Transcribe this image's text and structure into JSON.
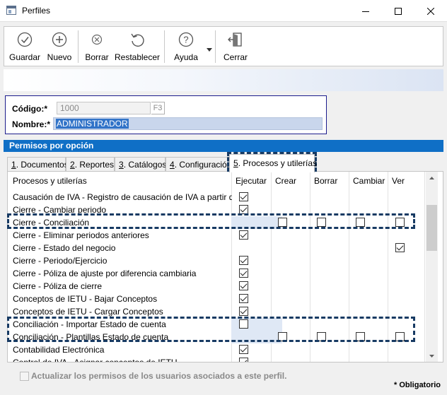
{
  "window": {
    "title": "Perfiles"
  },
  "toolbar": {
    "guardar": "Guardar",
    "nuevo": "Nuevo",
    "borrar": "Borrar",
    "restablecer": "Restablecer",
    "ayuda": "Ayuda",
    "cerrar": "Cerrar"
  },
  "form": {
    "codigo_label": "Código:*",
    "codigo_value": "1000",
    "codigo_hint": "F3",
    "nombre_label": "Nombre:*",
    "nombre_value": "ADMINISTRADOR"
  },
  "section_title": "Permisos por opción",
  "tabs": [
    {
      "key": "1",
      "label": ". Documentos"
    },
    {
      "key": "2",
      "label": ". Reportes"
    },
    {
      "key": "3",
      "label": ". Catálogos"
    },
    {
      "key": "4",
      "label": ". Configuración"
    },
    {
      "key": "5",
      "label": ". Procesos y utilerías",
      "active": true
    }
  ],
  "grid": {
    "columns": [
      "Procesos y utilerías",
      "Ejecutar",
      "Crear",
      "Borrar",
      "Cambiar",
      "Ver"
    ],
    "rows": [
      {
        "name": "Causación de IVA - Registro de causación de IVA a partir de l...",
        "ejecutar": true
      },
      {
        "name": "Cierre - Cambiar periodo",
        "ejecutar": true
      },
      {
        "name": "Cierre - Conciliación",
        "crear": false,
        "borrar": false,
        "cambiar": false,
        "ver": false,
        "highlight": true
      },
      {
        "name": "Cierre - Eliminar periodos anteriores",
        "ejecutar": true
      },
      {
        "name": "Cierre - Estado del negocio",
        "ver": true
      },
      {
        "name": "Cierre - Periodo/Ejercicio",
        "ejecutar": true
      },
      {
        "name": "Cierre - Póliza de ajuste por diferencia cambiaria",
        "ejecutar": true
      },
      {
        "name": "Cierre - Póliza de cierre",
        "ejecutar": true
      },
      {
        "name": "Conceptos de IETU - Bajar Conceptos",
        "ejecutar": true
      },
      {
        "name": "Conceptos de IETU - Cargar Conceptos",
        "ejecutar": true
      },
      {
        "name": "Conciliación - Importar Estado de cuenta",
        "ejecutar": false,
        "highlight": true
      },
      {
        "name": "Conciliación - Plantillas Estado de cuenta",
        "crear": false,
        "borrar": false,
        "cambiar": false,
        "ver": false,
        "highlight": true
      },
      {
        "name": "Contabilidad Electrónica",
        "ejecutar": true
      },
      {
        "name": "Control de IVA - Asignar conceptos de IETU",
        "ejecutar": true
      }
    ]
  },
  "footer": {
    "update_checkbox_label": "Actualizar los permisos de los usuarios asociados a este perfil.",
    "required_note": "* Obligatorio"
  }
}
